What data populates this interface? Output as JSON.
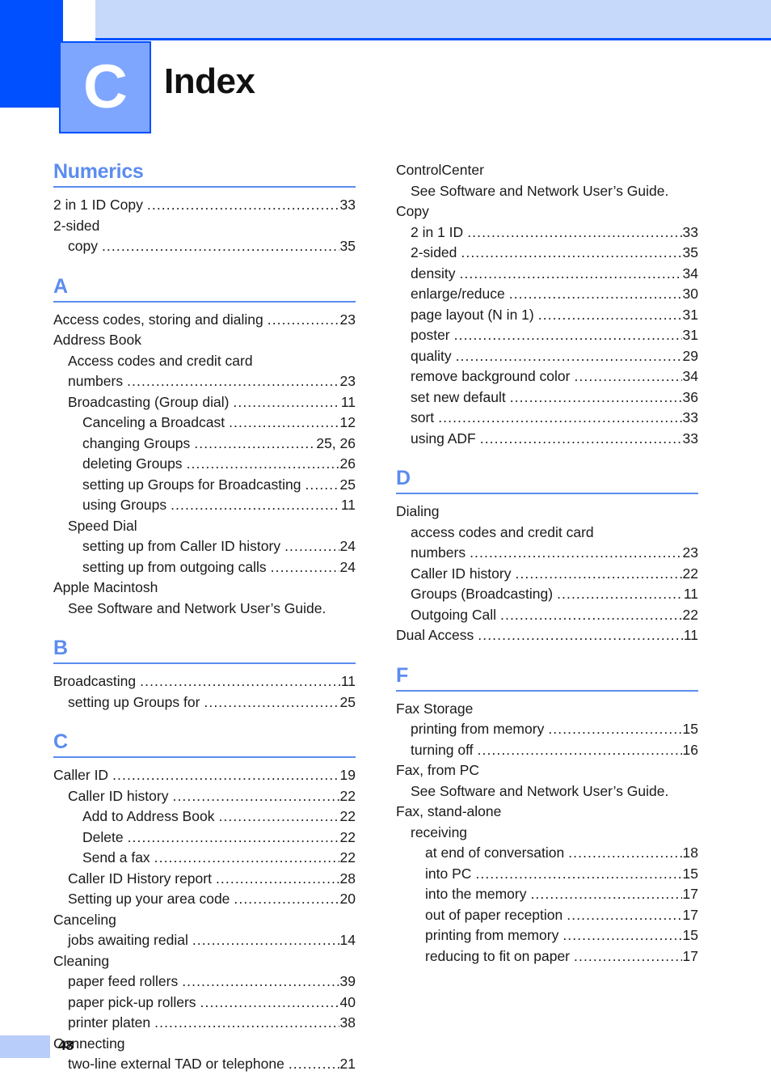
{
  "header": {
    "chapter_letter": "C",
    "title": "Index"
  },
  "footer": {
    "page_number": "48"
  },
  "columns": {
    "left": [
      {
        "heading": "Numerics",
        "heading_kind": "numerics",
        "entries": [
          {
            "level": 0,
            "text": "2 in 1 ID Copy",
            "page": "33",
            "dots": true
          },
          {
            "level": 0,
            "text": "2-sided",
            "dots": false
          },
          {
            "level": 1,
            "text": "copy",
            "page": "35",
            "dots": true
          }
        ]
      },
      {
        "heading": "A",
        "heading_kind": "letter",
        "entries": [
          {
            "level": 0,
            "text": "Access codes, storing and dialing",
            "page": "23",
            "dots": true
          },
          {
            "level": 0,
            "text": "Address Book",
            "dots": false
          },
          {
            "level": 1,
            "text": "Access codes and credit card",
            "dots": false
          },
          {
            "level": 1,
            "text": "numbers",
            "page": "23",
            "dots": true
          },
          {
            "level": 1,
            "text": "Broadcasting (Group dial)",
            "page": "11",
            "dots": true
          },
          {
            "level": 2,
            "text": "Canceling a Broadcast",
            "page": "12",
            "dots": true
          },
          {
            "level": 2,
            "text": "changing Groups",
            "page": "25, 26",
            "dots": true
          },
          {
            "level": 2,
            "text": "deleting Groups",
            "page": "26",
            "dots": true
          },
          {
            "level": 2,
            "text": "setting up Groups for Broadcasting",
            "page": "25",
            "dots": true
          },
          {
            "level": 2,
            "text": "using Groups",
            "page": "11",
            "dots": true
          },
          {
            "level": 1,
            "text": "Speed Dial",
            "dots": false
          },
          {
            "level": 2,
            "text": "setting up from Caller ID history",
            "page": "24",
            "dots": true
          },
          {
            "level": 2,
            "text": "setting up from outgoing calls",
            "page": "24",
            "dots": true
          },
          {
            "level": 0,
            "text": "Apple Macintosh",
            "dots": false
          },
          {
            "level": 1,
            "text": "See Software and Network User’s Guide.",
            "dots": false
          }
        ]
      },
      {
        "heading": "B",
        "heading_kind": "letter",
        "entries": [
          {
            "level": 0,
            "text": "Broadcasting",
            "page": "11",
            "dots": true
          },
          {
            "level": 1,
            "text": "setting up Groups for",
            "page": "25",
            "dots": true
          }
        ]
      },
      {
        "heading": "C",
        "heading_kind": "letter",
        "entries": [
          {
            "level": 0,
            "text": "Caller ID",
            "page": "19",
            "dots": true
          },
          {
            "level": 1,
            "text": "Caller ID history",
            "page": "22",
            "dots": true
          },
          {
            "level": 2,
            "text": "Add to Address Book",
            "page": "22",
            "dots": true
          },
          {
            "level": 2,
            "text": "Delete",
            "page": "22",
            "dots": true
          },
          {
            "level": 2,
            "text": "Send a fax",
            "page": "22",
            "dots": true
          },
          {
            "level": 1,
            "text": "Caller ID History report",
            "page": "28",
            "dots": true
          },
          {
            "level": 1,
            "text": "Setting up your area code",
            "page": "20",
            "dots": true
          },
          {
            "level": 0,
            "text": "Canceling",
            "dots": false
          },
          {
            "level": 1,
            "text": "jobs awaiting redial",
            "page": "14",
            "dots": true
          },
          {
            "level": 0,
            "text": "Cleaning",
            "dots": false
          },
          {
            "level": 1,
            "text": "paper feed rollers",
            "page": "39",
            "dots": true
          },
          {
            "level": 1,
            "text": "paper pick-up rollers",
            "page": "40",
            "dots": true
          },
          {
            "level": 1,
            "text": "printer platen",
            "page": "38",
            "dots": true
          },
          {
            "level": 0,
            "text": "Connecting",
            "dots": false
          },
          {
            "level": 1,
            "text": "two-line external TAD or telephone",
            "page": "21",
            "dots": true
          }
        ]
      }
    ],
    "right": [
      {
        "heading": null,
        "heading_kind": "none",
        "entries": [
          {
            "level": 0,
            "text": "ControlCenter",
            "dots": false
          },
          {
            "level": 1,
            "text": "See Software and Network User’s Guide.",
            "dots": false
          },
          {
            "level": 0,
            "text": "Copy",
            "dots": false
          },
          {
            "level": 1,
            "text": "2 in 1 ID",
            "page": "33",
            "dots": true
          },
          {
            "level": 1,
            "text": "2-sided",
            "page": "35",
            "dots": true
          },
          {
            "level": 1,
            "text": "density",
            "page": "34",
            "dots": true
          },
          {
            "level": 1,
            "text": "enlarge/reduce",
            "page": "30",
            "dots": true
          },
          {
            "level": 1,
            "text": "page layout (N in 1)",
            "page": "31",
            "dots": true
          },
          {
            "level": 1,
            "text": "poster",
            "page": "31",
            "dots": true
          },
          {
            "level": 1,
            "text": "quality",
            "page": "29",
            "dots": true
          },
          {
            "level": 1,
            "text": "remove background color",
            "page": "34",
            "dots": true
          },
          {
            "level": 1,
            "text": "set new default",
            "page": "36",
            "dots": true
          },
          {
            "level": 1,
            "text": "sort",
            "page": "33",
            "dots": true
          },
          {
            "level": 1,
            "text": "using ADF",
            "page": "33",
            "dots": true
          }
        ]
      },
      {
        "heading": "D",
        "heading_kind": "letter",
        "entries": [
          {
            "level": 0,
            "text": "Dialing",
            "dots": false
          },
          {
            "level": 1,
            "text": "access codes and credit card",
            "dots": false
          },
          {
            "level": 1,
            "text": "numbers",
            "page": "23",
            "dots": true
          },
          {
            "level": 1,
            "text": "Caller ID history",
            "page": "22",
            "dots": true
          },
          {
            "level": 1,
            "text": "Groups (Broadcasting)",
            "page": "11",
            "dots": true
          },
          {
            "level": 1,
            "text": "Outgoing Call",
            "page": "22",
            "dots": true
          },
          {
            "level": 0,
            "text": "Dual Access",
            "page": "11",
            "dots": true
          }
        ]
      },
      {
        "heading": "F",
        "heading_kind": "letter",
        "entries": [
          {
            "level": 0,
            "text": "Fax Storage",
            "dots": false
          },
          {
            "level": 1,
            "text": "printing from memory",
            "page": "15",
            "dots": true
          },
          {
            "level": 1,
            "text": "turning off",
            "page": "16",
            "dots": true
          },
          {
            "level": 0,
            "text": "Fax, from PC",
            "dots": false
          },
          {
            "level": 1,
            "text": "See Software and Network User’s Guide.",
            "dots": false
          },
          {
            "level": 0,
            "text": "Fax, stand-alone",
            "dots": false
          },
          {
            "level": 1,
            "text": "receiving",
            "dots": false
          },
          {
            "level": 2,
            "text": "at end of conversation",
            "page": "18",
            "dots": true
          },
          {
            "level": 2,
            "text": "into PC",
            "page": "15",
            "dots": true
          },
          {
            "level": 2,
            "text": "into the memory",
            "page": "17",
            "dots": true
          },
          {
            "level": 2,
            "text": "out of paper reception",
            "page": "17",
            "dots": true
          },
          {
            "level": 2,
            "text": "printing from memory",
            "page": "15",
            "dots": true
          },
          {
            "level": 2,
            "text": "reducing to fit on paper",
            "page": "17",
            "dots": true
          }
        ]
      }
    ]
  }
}
